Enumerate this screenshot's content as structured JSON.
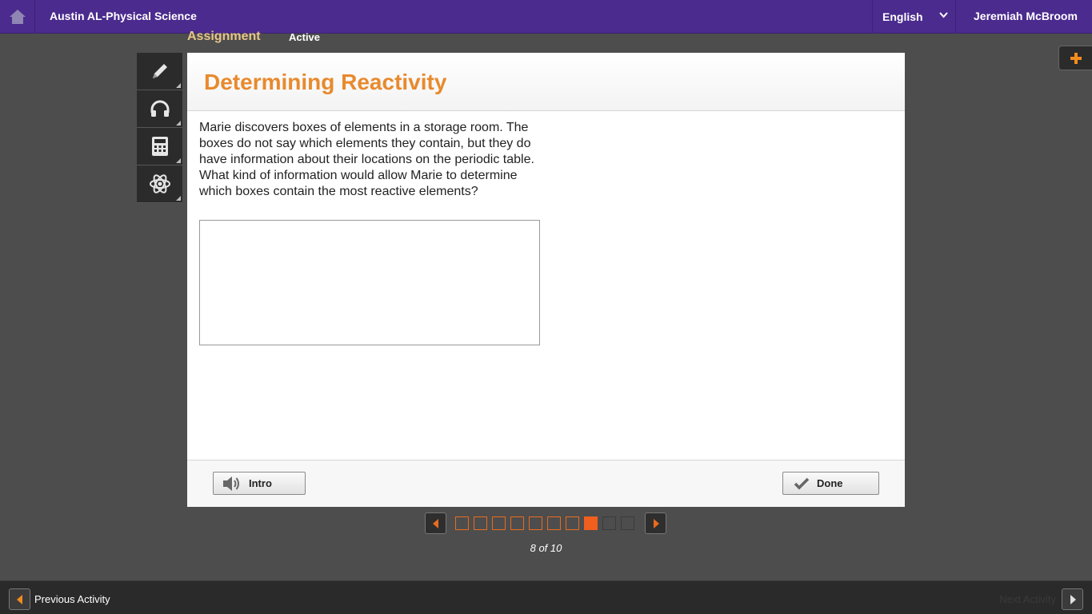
{
  "topbar": {
    "course_title": "Austin AL-Physical Science",
    "language": "English",
    "user_name": "Jeremiah McBroom"
  },
  "assignment": {
    "label": "Assignment",
    "status": "Active"
  },
  "activity": {
    "title": "Determining Reactivity",
    "question": "Marie discovers boxes of elements in a storage room. The boxes do not say which elements they contain, but they do have information about their locations on the periodic table. What kind of information would allow Marie to determine which boxes contain the most reactive elements?",
    "answer_value": ""
  },
  "footer": {
    "intro_label": "Intro",
    "done_label": "Done"
  },
  "pager": {
    "current": 8,
    "total": 10,
    "completed": 7,
    "text": "8 of 10"
  },
  "bottom": {
    "prev_label": "Previous Activity",
    "next_label": "Next Activity"
  },
  "colors": {
    "topbar": "#4b2b8e",
    "accent": "#e88a2e",
    "pager_current": "#f05f1e",
    "background": "#4d4d4d"
  },
  "icons": {
    "home": "home-icon",
    "tools": [
      "pencil-icon",
      "headphones-icon",
      "calculator-icon",
      "atom-icon"
    ],
    "plus": "plus-icon",
    "intro": "speaker-icon",
    "done": "checkmark-icon"
  }
}
